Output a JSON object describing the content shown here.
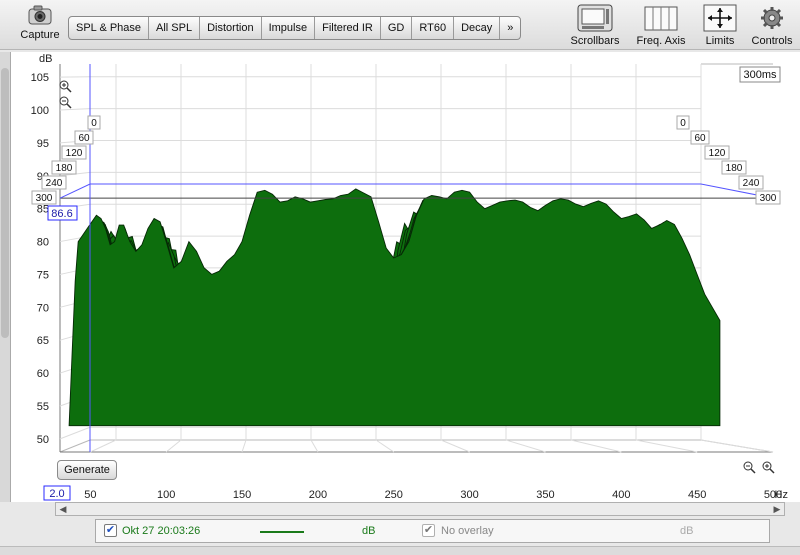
{
  "toolbar": {
    "capture_label": "Capture",
    "tabs": [
      "SPL & Phase",
      "All SPL",
      "Distortion",
      "Impulse",
      "Filtered IR",
      "GD",
      "RT60",
      "Decay",
      "»"
    ],
    "scrollbars_label": "Scrollbars",
    "freq_axis_label": "Freq. Axis",
    "limits_label": "Limits",
    "controls_label": "Controls"
  },
  "plot": {
    "y_unit": "dB",
    "x_unit": "Hz",
    "time_label": "300ms",
    "cursor_value": "86.6",
    "x_min_value": "2.0",
    "time_slices": [
      "0",
      "60",
      "120",
      "180",
      "240",
      "300"
    ]
  },
  "chart_data": {
    "type": "area",
    "y_ticks": [
      50,
      55,
      60,
      65,
      70,
      75,
      80,
      85,
      90,
      95,
      100,
      105
    ],
    "x_ticks": [
      50,
      100,
      150,
      200,
      250,
      300,
      350,
      400,
      450,
      500
    ],
    "xlim": [
      30,
      500
    ],
    "ylim": [
      48,
      107
    ],
    "zlim_ms": [
      0,
      300
    ],
    "fill_color": "#0d6e0d",
    "cursor_db": 86.6,
    "front_x": [
      36,
      38,
      40,
      42,
      45,
      48,
      51,
      54,
      57,
      60,
      63,
      66,
      69,
      72,
      76,
      80,
      84,
      88,
      92,
      96,
      100,
      105,
      110,
      115,
      120,
      125,
      130,
      135,
      140,
      145,
      150,
      155,
      160,
      165,
      170,
      175,
      180,
      185,
      190,
      195,
      200,
      205,
      210,
      215,
      220,
      225,
      230,
      235,
      240,
      245,
      250,
      255,
      260,
      265,
      270,
      275,
      280,
      285,
      290,
      295,
      300,
      305,
      310,
      315,
      320,
      325,
      330,
      335,
      340,
      345,
      350,
      355,
      360,
      365,
      370,
      375,
      380,
      385,
      390,
      395,
      400,
      405,
      410,
      415,
      420,
      425,
      430,
      435,
      440,
      445,
      450,
      455,
      460,
      465
    ],
    "front_y": [
      50,
      63,
      74,
      80,
      81,
      82,
      83,
      84,
      83.5,
      82,
      79.5,
      80,
      82.5,
      82.5,
      80,
      78.5,
      79.5,
      82,
      83.5,
      83,
      80,
      76,
      77,
      80,
      78.5,
      76,
      75,
      75.5,
      77,
      78,
      80,
      84,
      87.5,
      87.8,
      87.2,
      86,
      86.2,
      86.8,
      86.5,
      86,
      86.2,
      86.4,
      86.5,
      87,
      87.2,
      88,
      87.4,
      86.8,
      83,
      79,
      77.5,
      78,
      80,
      84,
      86.5,
      87,
      86.8,
      86.5,
      87.5,
      87.8,
      87.5,
      86,
      85,
      85.5,
      86,
      86.2,
      86.3,
      86,
      85.2,
      84.7,
      85.5,
      86.2,
      86.5,
      86.3,
      85.7,
      85.3,
      85.8,
      86.2,
      85.7,
      84.5,
      83.5,
      83.8,
      84.2,
      83.3,
      82,
      82.5,
      83.2,
      82.6,
      80.5,
      78,
      75,
      72,
      70,
      68
    ],
    "floor_db": 52
  },
  "generate_label": "Generate",
  "legend": {
    "measurement_name": "Okt 27 20:03:26",
    "measurement_unit": "dB",
    "measurement_color": "#1a7a1a",
    "overlay_label": "No overlay",
    "overlay_unit": "dB"
  }
}
